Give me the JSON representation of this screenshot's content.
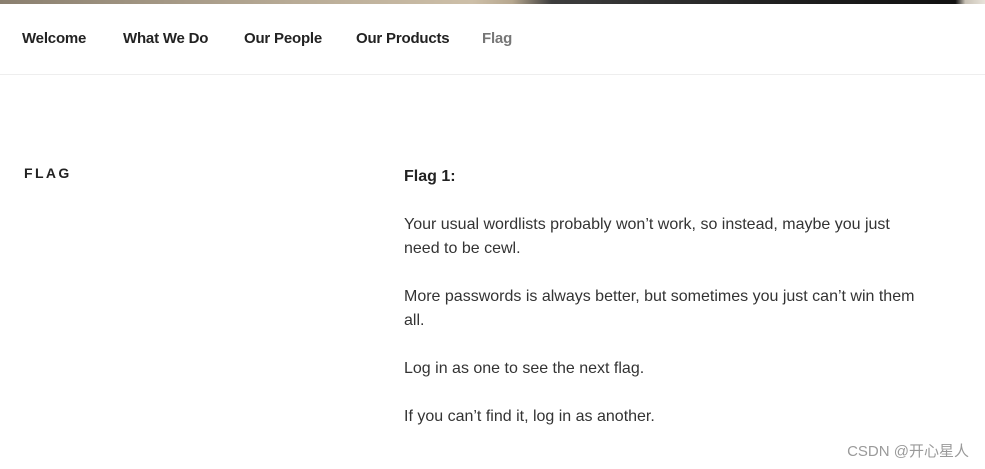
{
  "nav": {
    "items": [
      {
        "label": "Welcome"
      },
      {
        "label": "What We Do"
      },
      {
        "label": "Our People"
      },
      {
        "label": "Our Products"
      },
      {
        "label": "Flag"
      }
    ],
    "current": "Flag"
  },
  "page": {
    "title": "FLAG"
  },
  "content": {
    "heading": "Flag 1:",
    "paragraphs": [
      "Your usual wordlists probably won’t work, so instead, maybe you just need to be cewl.",
      "More passwords is always better, but sometimes you just can’t win them all.",
      "Log in as one to see the next flag.",
      "If you can’t find it, log in as another."
    ]
  },
  "watermark": {
    "text": "CSDN @开心星人"
  }
}
